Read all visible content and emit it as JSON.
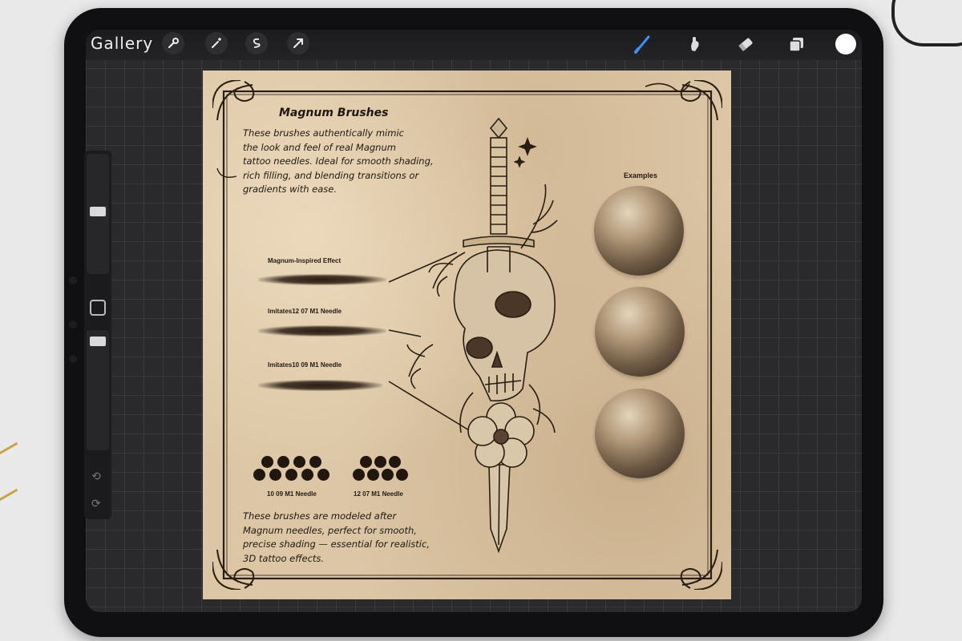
{
  "app": {
    "gallery_label": "Gallery",
    "toolbar_left_icons": [
      "wrench-icon",
      "magic-wand-icon",
      "selection-icon",
      "transform-arrow-icon"
    ],
    "toolbar_right_icons": [
      "brush-icon",
      "smudge-icon",
      "eraser-icon",
      "layers-icon",
      "color-picker-icon"
    ],
    "active_tool": "brush",
    "current_color": "#ffffff",
    "accent_color": "#3d8ff5"
  },
  "sidebar": {
    "size_slider_value": 0.5,
    "opacity_slider_value": 0.95,
    "icons": [
      "modify-button-icon",
      "undo-icon",
      "redo-icon"
    ]
  },
  "canvas": {
    "title": "Magnum Brushes",
    "intro_lines": [
      "These brushes authentically mimic",
      "the look and feel of real Magnum",
      "tattoo needles. Ideal for smooth shading,",
      "rich filling, and blending transitions or",
      "gradients with ease."
    ],
    "stroke_labels": [
      "Magnum-Inspired Effect",
      "Imitates12 07 M1 Needle",
      "Imitates10 09 M1 Needle"
    ],
    "examples_label": "Examples",
    "needle_labels": [
      "10 09 M1 Needle",
      "12 07 M1 Needle"
    ],
    "outro_lines": [
      "These brushes are modeled after",
      "Magnum needles, perfect for smooth,",
      "precise shading — essential for realistic,",
      "3D tattoo effects."
    ]
  }
}
